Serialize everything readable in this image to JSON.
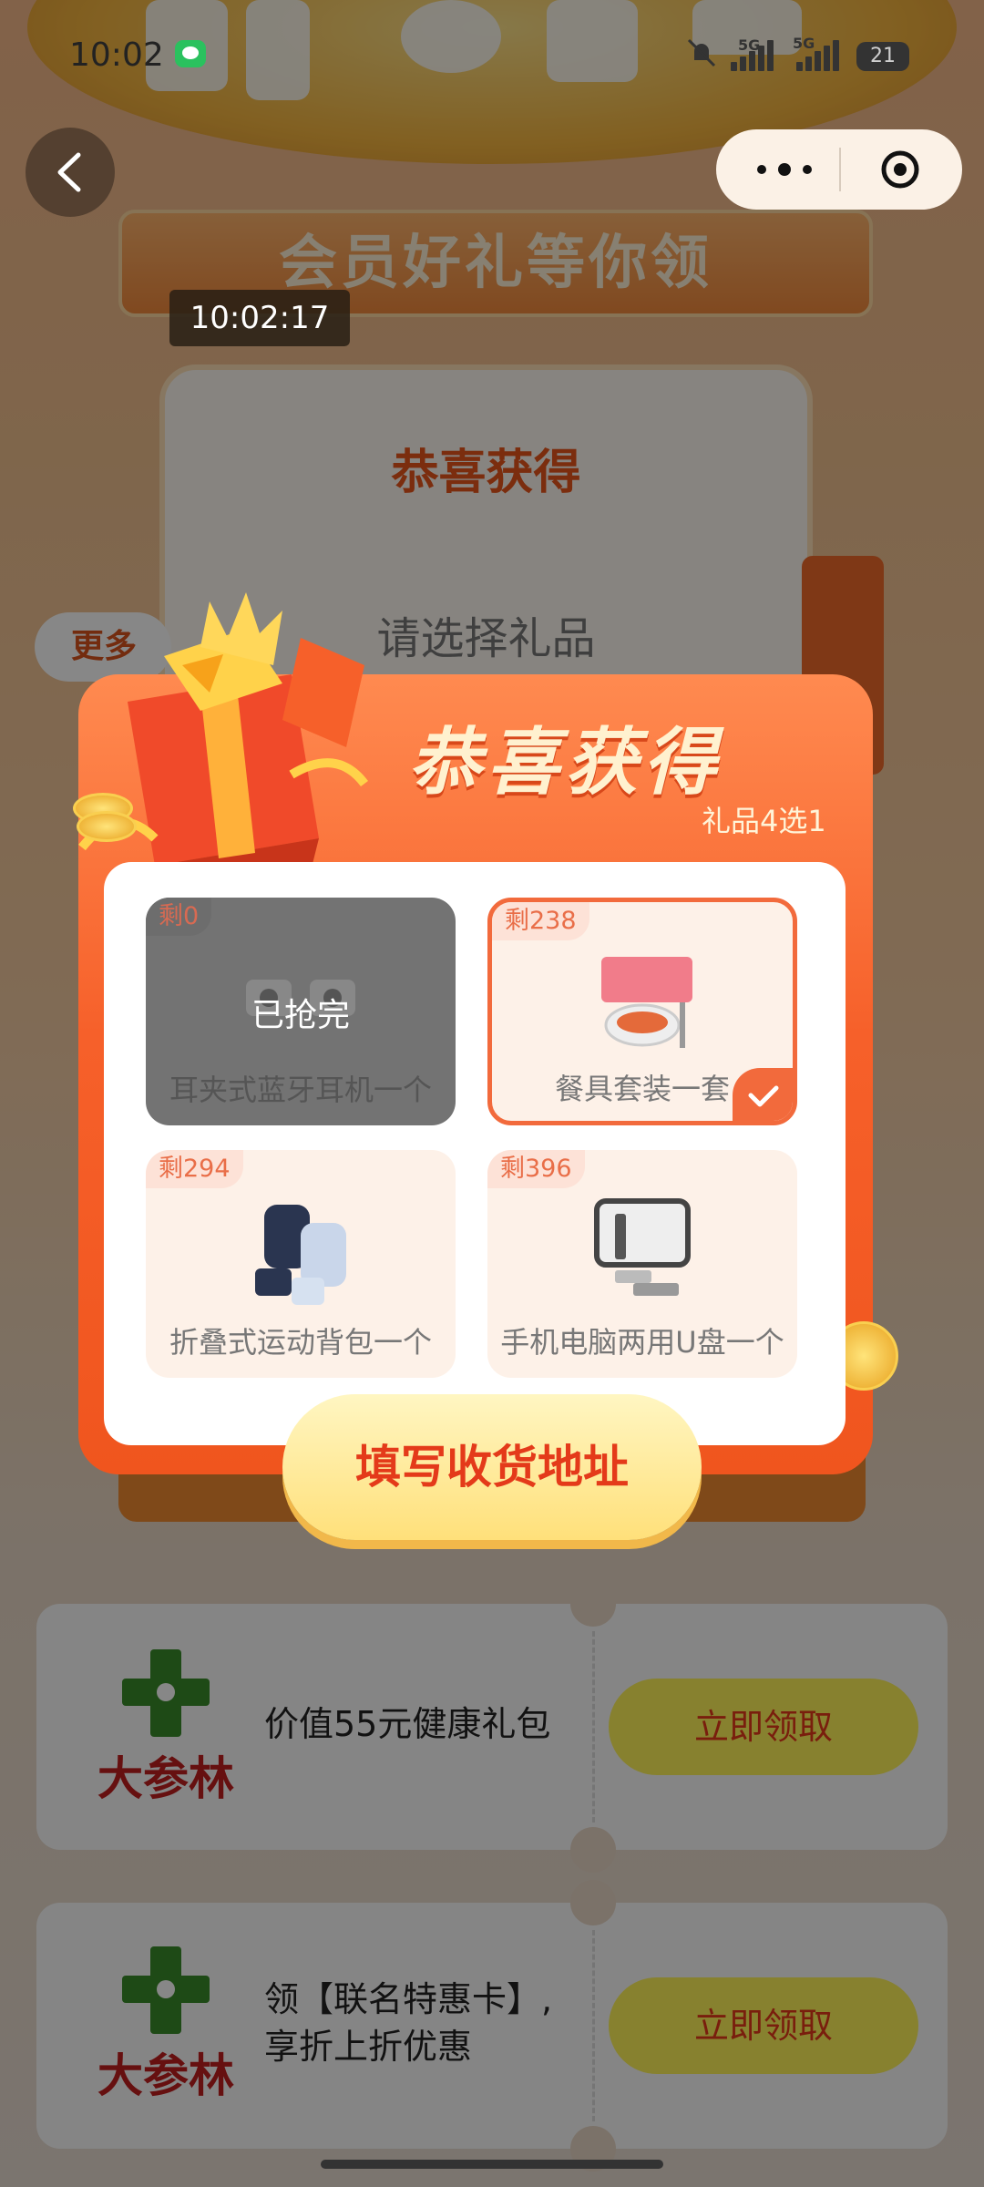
{
  "status_bar": {
    "time": "10:02",
    "network_1": "5G",
    "network_2": "5G",
    "battery": "21"
  },
  "page": {
    "banner_title": "会员好礼等你领",
    "card_title": "恭喜获得",
    "card_prompt": "请选择礼品",
    "more_label": "更多"
  },
  "overlay_time": "10:02:17",
  "modal": {
    "title": "恭喜获得",
    "subtitle": "礼品4选1",
    "gifts": [
      {
        "remain": "剩0",
        "name": "耳夹式蓝牙耳机一个",
        "status": "已抢完"
      },
      {
        "remain": "剩238",
        "name": "餐具套装一套"
      },
      {
        "remain": "剩294",
        "name": "折叠式运动背包一个"
      },
      {
        "remain": "剩396",
        "name": "手机电脑两用U盘一个"
      }
    ],
    "selected_index": 1,
    "address_button": "填写收货地址"
  },
  "coupons": [
    {
      "brand": "大参林",
      "desc": "价值55元健康礼包",
      "button": "立即领取"
    },
    {
      "brand": "大参林",
      "desc_line1": "领【联名特惠卡】,",
      "desc_line2": "享折上折优惠",
      "button": "立即领取"
    }
  ],
  "colors": {
    "accent": "#f6602a",
    "claim_button": "#fff45a",
    "brand_green": "#3a8c2a",
    "brand_red": "#c11f1f"
  }
}
